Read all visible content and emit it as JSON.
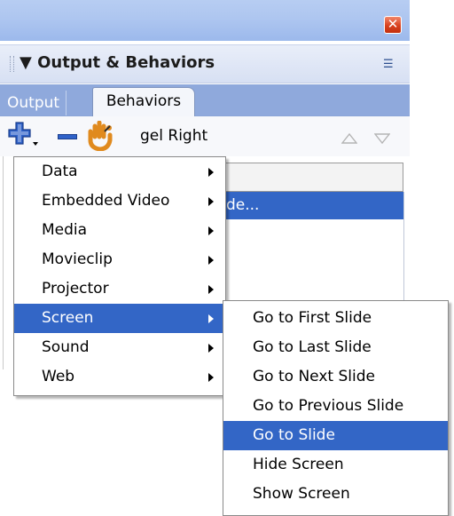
{
  "panel": {
    "title": "Output & Behaviors",
    "collapse_glyph": "▼",
    "close_glyph": "✕",
    "options_glyph": "☰",
    "tabs": [
      {
        "label": "Output",
        "active": false
      },
      {
        "label": "Behaviors",
        "active": true
      }
    ],
    "toolbar": {
      "instance_label": "gel Right",
      "up_glyph": "△",
      "down_glyph": "▽"
    },
    "list": {
      "selected_row_text": "de..."
    }
  },
  "menus": {
    "behavior_categories": [
      {
        "label": "Data",
        "has_submenu": true,
        "active": false
      },
      {
        "label": "Embedded Video",
        "has_submenu": true,
        "active": false
      },
      {
        "label": "Media",
        "has_submenu": true,
        "active": false
      },
      {
        "label": "Movieclip",
        "has_submenu": true,
        "active": false
      },
      {
        "label": "Projector",
        "has_submenu": true,
        "active": false
      },
      {
        "label": "Screen",
        "has_submenu": true,
        "active": true
      },
      {
        "label": "Sound",
        "has_submenu": true,
        "active": false
      },
      {
        "label": "Web",
        "has_submenu": true,
        "active": false
      }
    ],
    "screen_submenu": [
      {
        "label": "Go to First Slide",
        "active": false
      },
      {
        "label": "Go to Last Slide",
        "active": false
      },
      {
        "label": "Go to Next Slide",
        "active": false
      },
      {
        "label": "Go to Previous Slide",
        "active": false
      },
      {
        "label": "Go to Slide",
        "active": true
      },
      {
        "label": "Hide Screen",
        "active": false
      },
      {
        "label": "Show Screen",
        "active": false
      }
    ]
  },
  "colors": {
    "selection": "#3366c6",
    "titlebar": "#aec6f0",
    "tabbar": "#8fa9dc",
    "close_button": "#d8411e"
  },
  "icons": {
    "add": "add-behavior-icon",
    "remove": "remove-behavior-icon",
    "event": "event-handler-icon",
    "close": "close-icon",
    "options": "options-menu-icon"
  }
}
